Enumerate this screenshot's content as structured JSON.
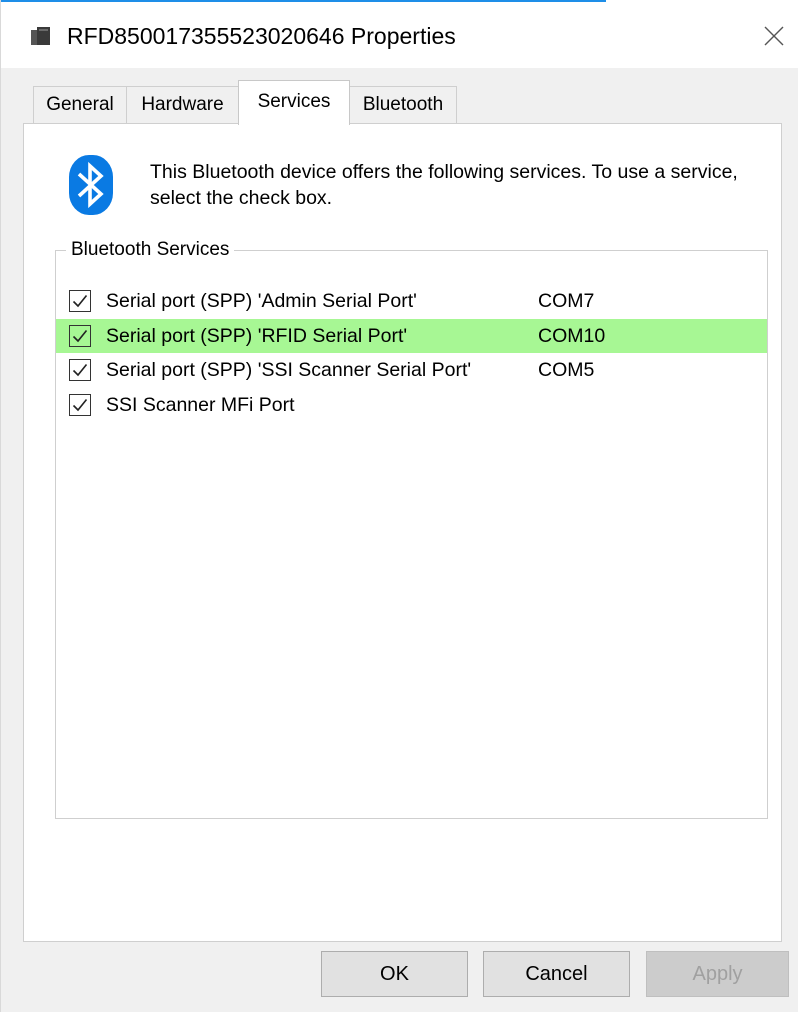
{
  "window": {
    "title": "RFD8500173555230206 46 Properties",
    "title_text": "RFD850017355523020646 Properties",
    "close_label": "×"
  },
  "tabs": [
    {
      "label": "General",
      "active": false
    },
    {
      "label": "Hardware",
      "active": false
    },
    {
      "label": "Services",
      "active": true
    },
    {
      "label": "Bluetooth",
      "active": false
    }
  ],
  "services_page": {
    "icon": "bluetooth-icon",
    "description": "This Bluetooth device offers the following services. To use a service, select the check box.",
    "group_label": "Bluetooth Services",
    "items": [
      {
        "name": "Serial port (SPP) 'Admin Serial Port'",
        "port": "COM7",
        "checked": true,
        "selected": false
      },
      {
        "name": "Serial port (SPP) 'RFID Serial Port'",
        "port": "COM10",
        "checked": true,
        "selected": true
      },
      {
        "name": "Serial port (SPP) 'SSI Scanner Serial Port'",
        "port": "COM5",
        "checked": true,
        "selected": false
      },
      {
        "name": "SSI Scanner MFi Port",
        "port": "",
        "checked": true,
        "selected": false
      }
    ]
  },
  "buttons": {
    "ok": "OK",
    "cancel": "Cancel",
    "apply": "Apply"
  },
  "colors": {
    "accent": "#1e8ee8",
    "bluetooth_blue": "#0a7ae3",
    "selection_green": "#a7f794"
  }
}
